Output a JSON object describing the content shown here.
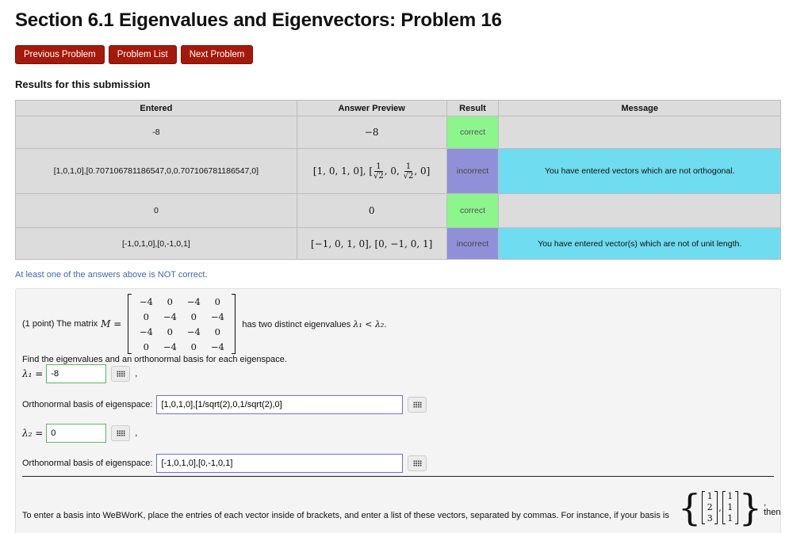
{
  "title": "Section 6.1 Eigenvalues and Eigenvectors: Problem 16",
  "nav": {
    "previous": "Previous Problem",
    "list": "Problem List",
    "next": "Next Problem"
  },
  "results": {
    "heading": "Results for this submission",
    "headers": [
      "Entered",
      "Answer Preview",
      "Result",
      "Message"
    ],
    "rows": [
      {
        "entered": "-8",
        "preview": "−8",
        "result": "correct",
        "message": ""
      },
      {
        "entered": "[1,0,1,0],[0.707106781186547,0,0.707106781186547,0]",
        "preview_prefix": "[1, 0, 1, 0], [",
        "preview_mid": ", 0, ",
        "preview_suffix": ", 0]",
        "frac_num": "1",
        "frac_den": "√2",
        "result": "incorrect",
        "message": "You have entered vectors which are not orthogonal."
      },
      {
        "entered": "0",
        "preview": "0",
        "result": "correct",
        "message": ""
      },
      {
        "entered": "[-1,0,1,0],[0,-1,0,1]",
        "preview": "[−1, 0, 1, 0], [0, −1, 0, 1]",
        "result": "incorrect",
        "message": "You have entered vector(s) which are not of unit length."
      }
    ],
    "status": "At least one of the answers above is NOT correct."
  },
  "problem": {
    "intro": "(1 point) The matrix",
    "matrix_symbol": "M =",
    "matrix": [
      [
        "−4",
        "0",
        "−4",
        "0"
      ],
      [
        "0",
        "−4",
        "0",
        "−4"
      ],
      [
        "−4",
        "0",
        "−4",
        "0"
      ],
      [
        "0",
        "−4",
        "0",
        "−4"
      ]
    ],
    "eig_text_a": "has two distinct eigenvalues",
    "eig_lam1": "λ₁ < λ₂",
    "eig_text_b": ".",
    "find_text": "Find the eigenvalues and an orthonormal basis for each eigenspace.",
    "lambda1_label": "λ₁ =",
    "lambda1_value": "-8",
    "basis_label": "Orthonormal basis of eigenspace:",
    "basis1_value": "[1,0,1,0],[1/sqrt(2),0,1/sqrt(2),0]",
    "lambda2_label": "λ₂ =",
    "lambda2_value": "0",
    "basis2_value": "[-1,0,1,0],[0,-1,0,1]",
    "comma": ",",
    "instructions": "To enter a basis into WeBWorK, place the entries of each vector inside of brackets, and enter a list of these vectors, separated by commas. For instance, if your basis is",
    "example_vec1": [
      "1",
      "2",
      "3"
    ],
    "example_vec2": [
      "1",
      "1",
      "1"
    ],
    "then": ", then"
  },
  "colors": {
    "button": "#a5190b",
    "correct": "#8cf58c",
    "incorrect": "#9090d8",
    "message_highlight": "#6fdcef",
    "status_text": "#3c6ba8"
  }
}
